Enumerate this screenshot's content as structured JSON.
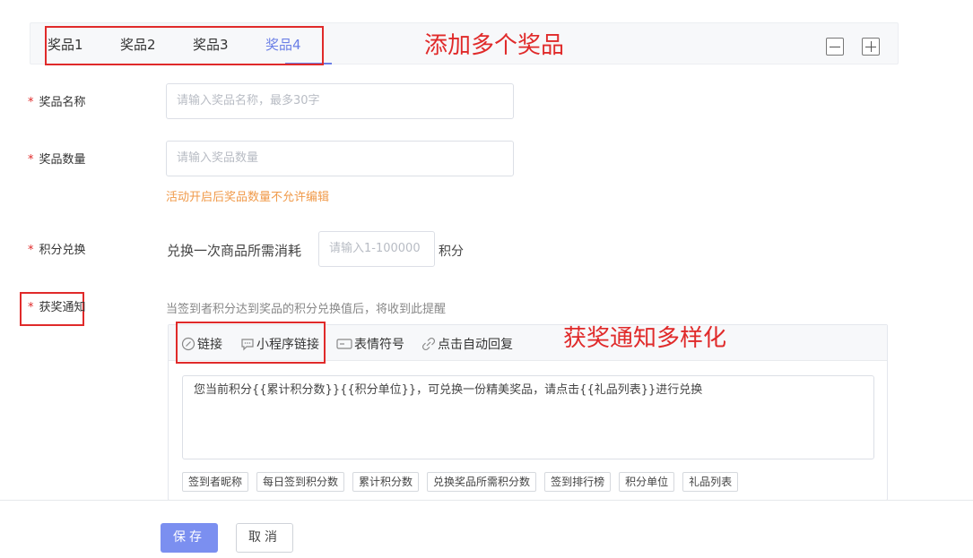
{
  "tabs": [
    {
      "label": "奖品1"
    },
    {
      "label": "奖品2"
    },
    {
      "label": "奖品3"
    },
    {
      "label": "奖品4",
      "active": true
    }
  ],
  "annotations": {
    "add_prizes": "添加多个奖品",
    "notify_variety": "获奖通知多样化"
  },
  "form": {
    "prize_name": {
      "label": "奖品名称",
      "placeholder": "请输入奖品名称，最多30字"
    },
    "prize_qty": {
      "label": "奖品数量",
      "placeholder": "请输入奖品数量",
      "hint": "活动开启后奖品数量不允许编辑"
    },
    "points": {
      "label": "积分兑换",
      "prefix": "兑换一次商品所需消耗",
      "placeholder": "请输入1-100000",
      "suffix": "积分"
    },
    "notify": {
      "label": "获奖通知",
      "description": "当签到者积分达到奖品的积分兑换值后，将收到此提醒",
      "toolbar": [
        "链接",
        "小程序链接",
        "表情符号",
        "点击自动回复"
      ],
      "content": "您当前积分{{累计积分数}}{{积分单位}}，可兑换一份精美奖品，请点击{{礼品列表}}进行兑换",
      "chips": [
        "签到者昵称",
        "每日签到积分数",
        "累计积分数",
        "兑换奖品所需积分数",
        "签到排行榜",
        "积分单位",
        "礼品列表"
      ]
    }
  },
  "buttons": {
    "save": "保存",
    "cancel": "取消"
  },
  "colors": {
    "accent": "#7b8ff0",
    "annotation_red": "#e02a2a",
    "hint_orange": "#f09a4a"
  }
}
